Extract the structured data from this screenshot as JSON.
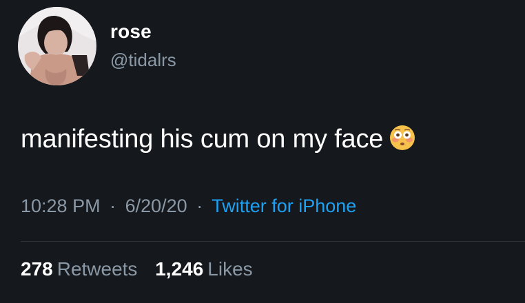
{
  "user": {
    "display_name": "rose",
    "handle": "@tidalrs"
  },
  "tweet": {
    "text": "manifesting his cum on my face",
    "emoji": "flushed-face-emoji"
  },
  "meta": {
    "time": "10:28 PM",
    "date": "6/20/20",
    "separator": "·",
    "source": "Twitter for iPhone"
  },
  "stats": {
    "retweets_count": "278",
    "retweets_label": "Retweets",
    "likes_count": "1,246",
    "likes_label": "Likes"
  },
  "colors": {
    "background": "#15181d",
    "text_primary": "#ffffff",
    "text_secondary": "#8b98a5",
    "link": "#1da1f2"
  }
}
